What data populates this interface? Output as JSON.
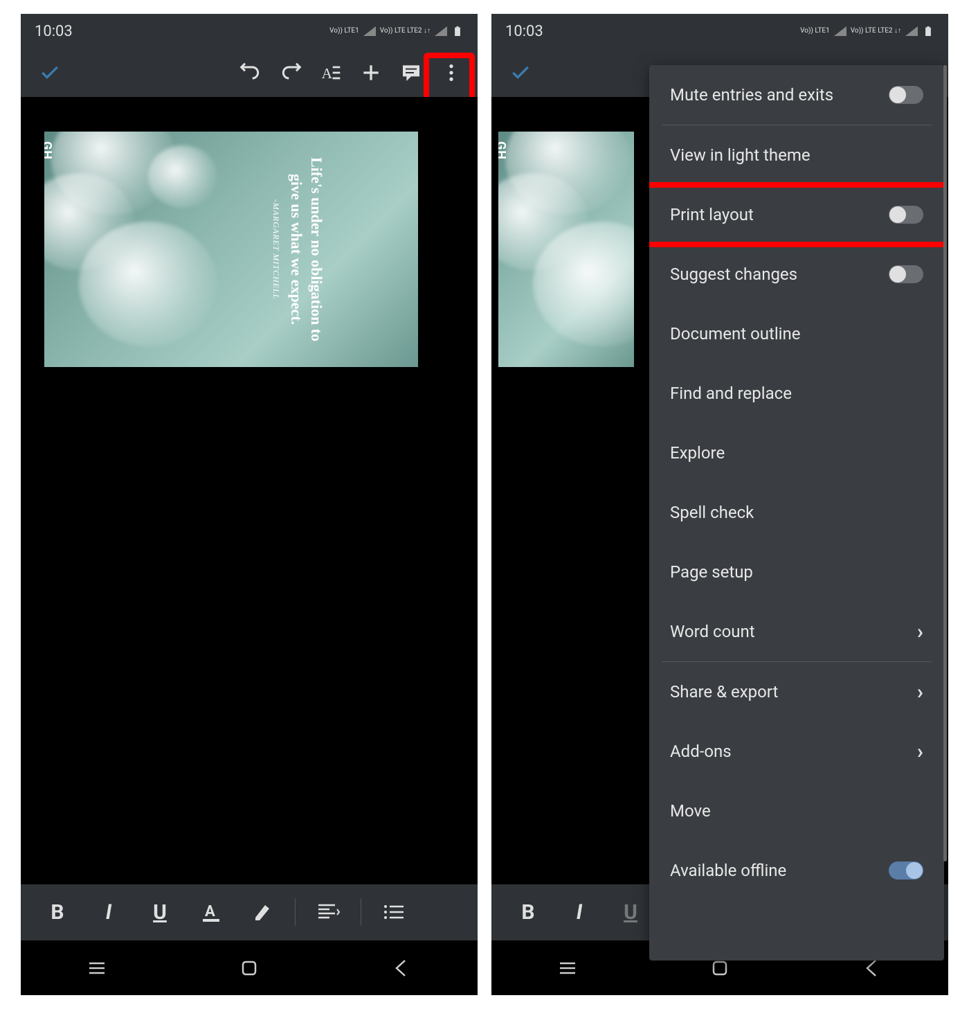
{
  "status": {
    "time": "10:03",
    "lte1": "Vo)) LTE1",
    "lte2": "Vo)) LTE LTE2 ↓↑"
  },
  "doc_image": {
    "badge": "GH",
    "quote": "Life's under no obligation to give us what we expect.",
    "author": "-MARGARET MITCHELL"
  },
  "format_labels": {
    "bold": "B",
    "italic": "I",
    "underline": "U",
    "textcolor": "A"
  },
  "menu": {
    "items": [
      {
        "label": "Mute entries and exits",
        "type": "toggle",
        "on": false
      },
      {
        "label": "View in light theme",
        "type": "plain"
      },
      {
        "label": "Print layout",
        "type": "toggle",
        "on": false,
        "highlight": true
      },
      {
        "label": "Suggest changes",
        "type": "toggle",
        "on": false
      },
      {
        "label": "Document outline",
        "type": "plain"
      },
      {
        "label": "Find and replace",
        "type": "plain"
      },
      {
        "label": "Explore",
        "type": "plain"
      },
      {
        "label": "Spell check",
        "type": "plain"
      },
      {
        "label": "Page setup",
        "type": "plain"
      },
      {
        "label": "Word count",
        "type": "arrow"
      },
      {
        "label": "Share & export",
        "type": "arrow",
        "divider_before": true
      },
      {
        "label": "Add-ons",
        "type": "arrow"
      },
      {
        "label": "Move",
        "type": "plain"
      },
      {
        "label": "Available offline",
        "type": "toggle",
        "on": true
      }
    ]
  }
}
